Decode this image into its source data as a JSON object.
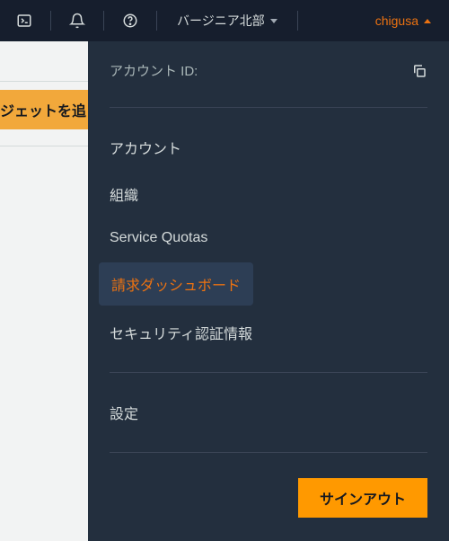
{
  "topbar": {
    "region_label": "バージニア北部",
    "user_label": "chigusa"
  },
  "dropdown": {
    "account_id_label": "アカウント ID:",
    "menu_group1": [
      {
        "label": "アカウント",
        "active": false
      },
      {
        "label": "組織",
        "active": false
      },
      {
        "label": "Service Quotas",
        "active": false
      },
      {
        "label": "請求ダッシュボード",
        "active": true
      },
      {
        "label": "セキュリティ認証情報",
        "active": false
      }
    ],
    "menu_group2": [
      {
        "label": "設定",
        "active": false
      }
    ],
    "signout_label": "サインアウト"
  },
  "background": {
    "widget_button_fragment": "ジェットを追"
  }
}
